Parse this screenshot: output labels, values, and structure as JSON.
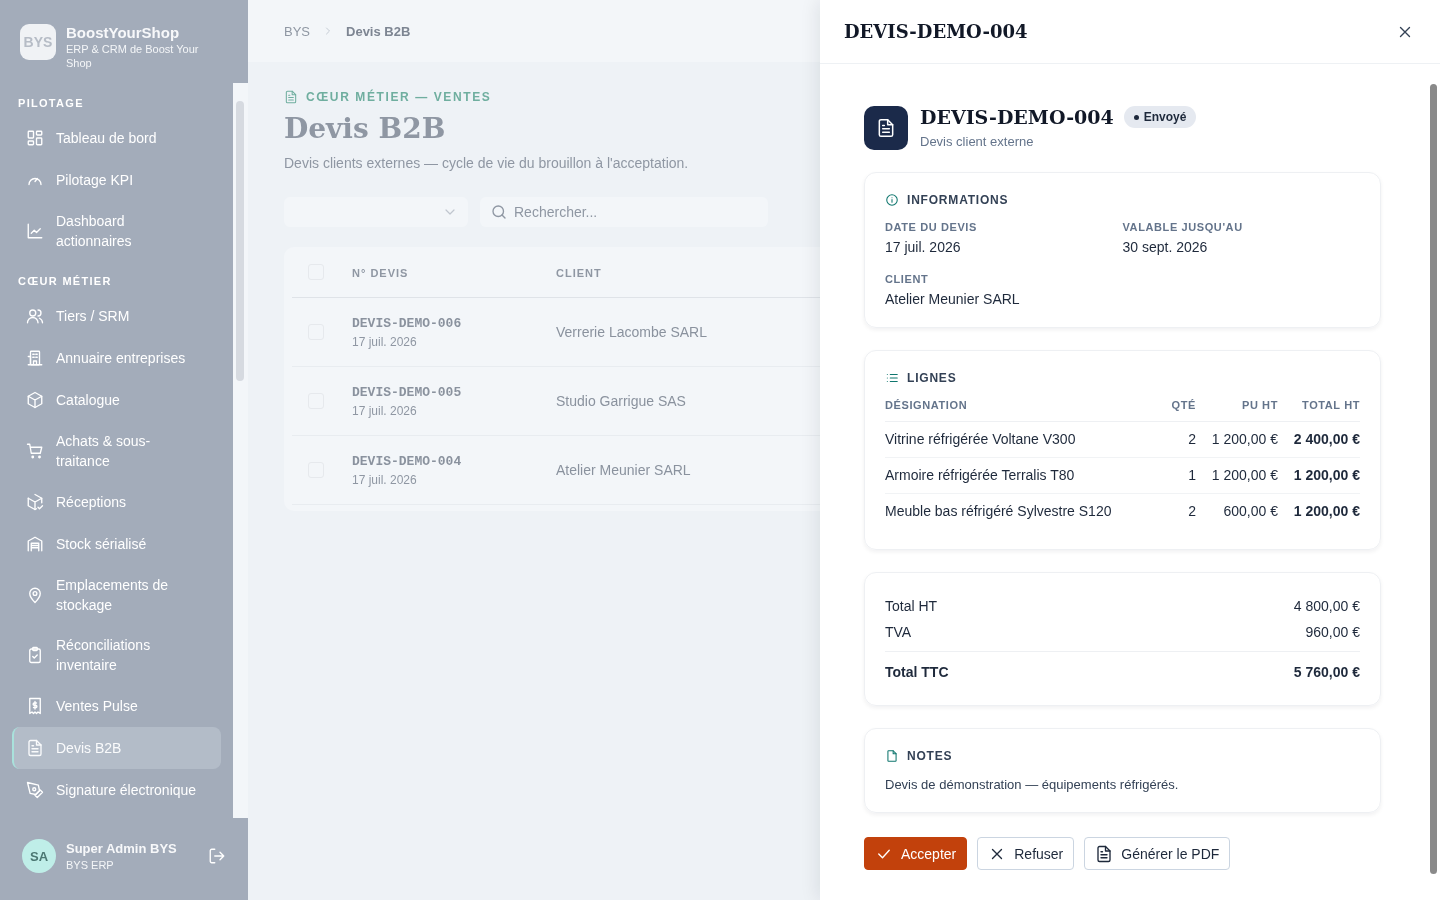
{
  "brand": {
    "logo": "BYS",
    "name": "BoostYourShop",
    "subtitle": "ERP & CRM de Boost Your Shop"
  },
  "sidebar": {
    "sections": [
      {
        "title": "PILOTAGE",
        "items": [
          {
            "label": "Tableau de bord",
            "selected": false
          },
          {
            "label": "Pilotage KPI",
            "selected": false
          },
          {
            "label": "Dashboard actionnaires",
            "selected": false
          }
        ]
      },
      {
        "title": "CŒUR MÉTIER",
        "items": [
          {
            "label": "Tiers / SRM",
            "selected": false
          },
          {
            "label": "Annuaire entreprises",
            "selected": false
          },
          {
            "label": "Catalogue",
            "selected": false
          },
          {
            "label": "Achats & sous-traitance",
            "selected": false
          },
          {
            "label": "Réceptions",
            "selected": false
          },
          {
            "label": "Stock sérialisé",
            "selected": false
          },
          {
            "label": "Emplacements de stockage",
            "selected": false
          },
          {
            "label": "Réconciliations inventaire",
            "selected": false
          },
          {
            "label": "Ventes Pulse",
            "selected": false
          },
          {
            "label": "Devis B2B",
            "selected": true
          },
          {
            "label": "Signature électronique",
            "selected": false
          }
        ]
      }
    ]
  },
  "user": {
    "initials": "SA",
    "name": "Super Admin BYS",
    "subtitle": "BYS ERP"
  },
  "breadcrumb": [
    "BYS",
    "Devis B2B"
  ],
  "page": {
    "eyebrow": "CŒUR MÉTIER — VENTES",
    "title": "Devis B2B",
    "subtitle": "Devis clients externes — cycle de vie du brouillon à l'acceptation."
  },
  "filters": {
    "search_placeholder": "Rechercher..."
  },
  "table": {
    "columns": [
      "N° DEVIS",
      "CLIENT"
    ],
    "header_checked": false,
    "rows": [
      {
        "number": "DEVIS-DEMO-006",
        "date": "17 juil. 2026",
        "client": "Verrerie Lacombe SARL",
        "checked": false
      },
      {
        "number": "DEVIS-DEMO-005",
        "date": "17 juil. 2026",
        "client": "Studio Garrigue SAS",
        "checked": false
      },
      {
        "number": "DEVIS-DEMO-004",
        "date": "17 juil. 2026",
        "client": "Atelier Meunier SARL",
        "checked": false
      }
    ]
  },
  "drawer": {
    "title": "DEVIS-DEMO-004",
    "heading": "DEVIS-DEMO-004",
    "status": "Envoyé",
    "subtitle": "Devis client externe",
    "informations": {
      "title": "INFORMATIONS",
      "fields": [
        {
          "label": "DATE DU DEVIS",
          "value": "17 juil. 2026"
        },
        {
          "label": "VALABLE JUSQU'AU",
          "value": "30 sept. 2026"
        },
        {
          "label": "CLIENT",
          "value": "Atelier Meunier SARL"
        }
      ]
    },
    "lines": {
      "title": "LIGNES",
      "columns": [
        "DÉSIGNATION",
        "QTÉ",
        "PU HT",
        "TOTAL HT"
      ],
      "rows": [
        {
          "designation": "Vitrine réfrigérée Voltane V300",
          "qty": "2",
          "unit_price": "1 200,00 €",
          "total": "2 400,00 €"
        },
        {
          "designation": "Armoire réfrigérée Terralis T80",
          "qty": "1",
          "unit_price": "1 200,00 €",
          "total": "1 200,00 €"
        },
        {
          "designation": "Meuble bas réfrigéré Sylvestre S120",
          "qty": "2",
          "unit_price": "600,00 €",
          "total": "1 200,00 €"
        }
      ]
    },
    "totals": [
      {
        "label": "Total HT",
        "value": "4 800,00 €",
        "kind": "line"
      },
      {
        "label": "TVA",
        "value": "960,00 €",
        "kind": "line"
      },
      {
        "label": "Total TTC",
        "value": "5 760,00 €",
        "kind": "total"
      }
    ],
    "notes": {
      "title": "NOTES",
      "text": "Devis de démonstration — équipements réfrigérés."
    },
    "actions": [
      {
        "label": "Accepter",
        "kind": "primary"
      },
      {
        "label": "Refuser",
        "kind": "reject"
      },
      {
        "label": "Générer le PDF",
        "kind": "pdf"
      }
    ]
  }
}
